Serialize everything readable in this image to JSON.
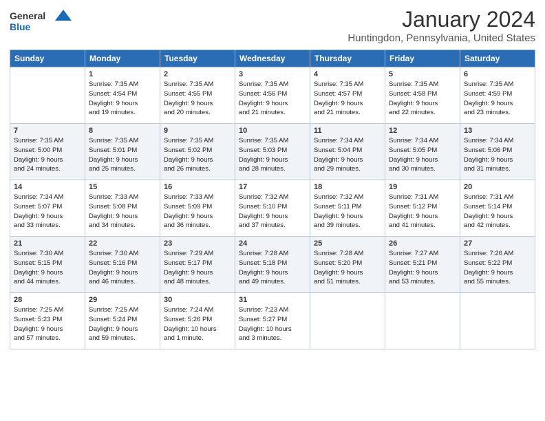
{
  "header": {
    "logo_line1": "General",
    "logo_line2": "Blue",
    "month": "January 2024",
    "location": "Huntingdon, Pennsylvania, United States"
  },
  "days_of_week": [
    "Sunday",
    "Monday",
    "Tuesday",
    "Wednesday",
    "Thursday",
    "Friday",
    "Saturday"
  ],
  "weeks": [
    [
      {
        "day": "",
        "content": ""
      },
      {
        "day": "1",
        "content": "Sunrise: 7:35 AM\nSunset: 4:54 PM\nDaylight: 9 hours\nand 19 minutes."
      },
      {
        "day": "2",
        "content": "Sunrise: 7:35 AM\nSunset: 4:55 PM\nDaylight: 9 hours\nand 20 minutes."
      },
      {
        "day": "3",
        "content": "Sunrise: 7:35 AM\nSunset: 4:56 PM\nDaylight: 9 hours\nand 21 minutes."
      },
      {
        "day": "4",
        "content": "Sunrise: 7:35 AM\nSunset: 4:57 PM\nDaylight: 9 hours\nand 21 minutes."
      },
      {
        "day": "5",
        "content": "Sunrise: 7:35 AM\nSunset: 4:58 PM\nDaylight: 9 hours\nand 22 minutes."
      },
      {
        "day": "6",
        "content": "Sunrise: 7:35 AM\nSunset: 4:59 PM\nDaylight: 9 hours\nand 23 minutes."
      }
    ],
    [
      {
        "day": "7",
        "content": "Sunrise: 7:35 AM\nSunset: 5:00 PM\nDaylight: 9 hours\nand 24 minutes."
      },
      {
        "day": "8",
        "content": "Sunrise: 7:35 AM\nSunset: 5:01 PM\nDaylight: 9 hours\nand 25 minutes."
      },
      {
        "day": "9",
        "content": "Sunrise: 7:35 AM\nSunset: 5:02 PM\nDaylight: 9 hours\nand 26 minutes."
      },
      {
        "day": "10",
        "content": "Sunrise: 7:35 AM\nSunset: 5:03 PM\nDaylight: 9 hours\nand 28 minutes."
      },
      {
        "day": "11",
        "content": "Sunrise: 7:34 AM\nSunset: 5:04 PM\nDaylight: 9 hours\nand 29 minutes."
      },
      {
        "day": "12",
        "content": "Sunrise: 7:34 AM\nSunset: 5:05 PM\nDaylight: 9 hours\nand 30 minutes."
      },
      {
        "day": "13",
        "content": "Sunrise: 7:34 AM\nSunset: 5:06 PM\nDaylight: 9 hours\nand 31 minutes."
      }
    ],
    [
      {
        "day": "14",
        "content": "Sunrise: 7:34 AM\nSunset: 5:07 PM\nDaylight: 9 hours\nand 33 minutes."
      },
      {
        "day": "15",
        "content": "Sunrise: 7:33 AM\nSunset: 5:08 PM\nDaylight: 9 hours\nand 34 minutes."
      },
      {
        "day": "16",
        "content": "Sunrise: 7:33 AM\nSunset: 5:09 PM\nDaylight: 9 hours\nand 36 minutes."
      },
      {
        "day": "17",
        "content": "Sunrise: 7:32 AM\nSunset: 5:10 PM\nDaylight: 9 hours\nand 37 minutes."
      },
      {
        "day": "18",
        "content": "Sunrise: 7:32 AM\nSunset: 5:11 PM\nDaylight: 9 hours\nand 39 minutes."
      },
      {
        "day": "19",
        "content": "Sunrise: 7:31 AM\nSunset: 5:12 PM\nDaylight: 9 hours\nand 41 minutes."
      },
      {
        "day": "20",
        "content": "Sunrise: 7:31 AM\nSunset: 5:14 PM\nDaylight: 9 hours\nand 42 minutes."
      }
    ],
    [
      {
        "day": "21",
        "content": "Sunrise: 7:30 AM\nSunset: 5:15 PM\nDaylight: 9 hours\nand 44 minutes."
      },
      {
        "day": "22",
        "content": "Sunrise: 7:30 AM\nSunset: 5:16 PM\nDaylight: 9 hours\nand 46 minutes."
      },
      {
        "day": "23",
        "content": "Sunrise: 7:29 AM\nSunset: 5:17 PM\nDaylight: 9 hours\nand 48 minutes."
      },
      {
        "day": "24",
        "content": "Sunrise: 7:28 AM\nSunset: 5:18 PM\nDaylight: 9 hours\nand 49 minutes."
      },
      {
        "day": "25",
        "content": "Sunrise: 7:28 AM\nSunset: 5:20 PM\nDaylight: 9 hours\nand 51 minutes."
      },
      {
        "day": "26",
        "content": "Sunrise: 7:27 AM\nSunset: 5:21 PM\nDaylight: 9 hours\nand 53 minutes."
      },
      {
        "day": "27",
        "content": "Sunrise: 7:26 AM\nSunset: 5:22 PM\nDaylight: 9 hours\nand 55 minutes."
      }
    ],
    [
      {
        "day": "28",
        "content": "Sunrise: 7:25 AM\nSunset: 5:23 PM\nDaylight: 9 hours\nand 57 minutes."
      },
      {
        "day": "29",
        "content": "Sunrise: 7:25 AM\nSunset: 5:24 PM\nDaylight: 9 hours\nand 59 minutes."
      },
      {
        "day": "30",
        "content": "Sunrise: 7:24 AM\nSunset: 5:26 PM\nDaylight: 10 hours\nand 1 minute."
      },
      {
        "day": "31",
        "content": "Sunrise: 7:23 AM\nSunset: 5:27 PM\nDaylight: 10 hours\nand 3 minutes."
      },
      {
        "day": "",
        "content": ""
      },
      {
        "day": "",
        "content": ""
      },
      {
        "day": "",
        "content": ""
      }
    ]
  ]
}
